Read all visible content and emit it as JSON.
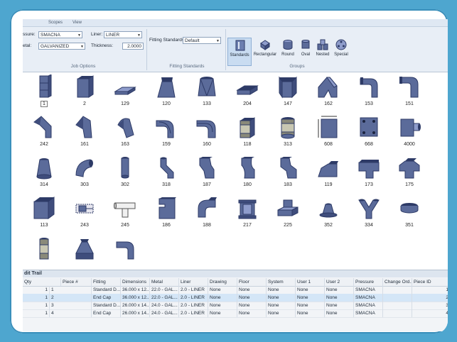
{
  "ribbon": {
    "tabs": [
      "Scopes",
      "View"
    ],
    "pressure_label": "ssure:",
    "pressure_value": "SMACNA",
    "metal_label": "etal:",
    "metal_value": "GALVANIZED",
    "liner_label": "Liner:",
    "liner_value": "LINER",
    "thickness_label": "Thickness:",
    "thickness_value": "2.0000",
    "job_options_title": "Job Options",
    "fitting_standards_label": "Fitting Standards",
    "fitting_standards_value": "Default",
    "fitting_standards_title": "Fitting Standards",
    "groups_title": "Groups",
    "groups": [
      {
        "label": "Standards",
        "icon": "standards-icon",
        "active": true
      },
      {
        "label": "Rectangular",
        "icon": "rectangular-icon",
        "active": false
      },
      {
        "label": "Round",
        "icon": "round-icon",
        "active": false
      },
      {
        "label": "Oval",
        "icon": "oval-icon",
        "active": false
      },
      {
        "label": "Nested",
        "icon": "nested-icon",
        "active": false
      },
      {
        "label": "Special",
        "icon": "special-icon",
        "active": false
      }
    ]
  },
  "fittings": [
    [
      "1",
      "2",
      "129",
      "120",
      "133",
      "204",
      "147",
      "162",
      "153",
      "151"
    ],
    [
      "242",
      "161",
      "163",
      "159",
      "160",
      "118",
      "313",
      "608",
      "668",
      "4000"
    ],
    [
      "314",
      "303",
      "302",
      "318",
      "187",
      "180",
      "183",
      "119",
      "173",
      "175"
    ],
    [
      "113",
      "243",
      "245",
      "186",
      "188",
      "217",
      "225",
      "352",
      "334",
      "351"
    ],
    [
      "",
      "",
      ""
    ]
  ],
  "audit": {
    "title": "dit Trail",
    "columns": [
      "Qty",
      "Piece #",
      "Fitting",
      "Dimensions",
      "Metal",
      "Liner",
      "Drawing",
      "Floor",
      "System",
      "User 1",
      "User 2",
      "Pressure",
      "Change Ord...",
      "Piece ID"
    ],
    "rows": [
      [
        "1",
        "1",
        "Standard D...",
        "36.000 x 12...",
        "22.0 - GAL...",
        "2.0 - LINER",
        "None",
        "None",
        "None",
        "None",
        "None",
        "SMACNA",
        "",
        "1"
      ],
      [
        "1",
        "2",
        "End Cap",
        "36.000 x 12...",
        "22.0 - GAL...",
        "2.0 - LINER",
        "None",
        "None",
        "None",
        "None",
        "None",
        "SMACNA",
        "",
        "2"
      ],
      [
        "1",
        "3",
        "Standard D...",
        "26.000 x 14...",
        "24.0 - GAL...",
        "2.0 - LINER",
        "None",
        "None",
        "None",
        "None",
        "None",
        "SMACNA",
        "",
        "3"
      ],
      [
        "1",
        "4",
        "End Cap",
        "26.000 x 14...",
        "24.0 - GAL...",
        "2.0 - LINER",
        "None",
        "None",
        "None",
        "None",
        "None",
        "SMACNA",
        "",
        "4"
      ]
    ],
    "selected_row": 1
  },
  "colors": {
    "accent_blue": "#5b6b9a",
    "accent_dark": "#2d3a66",
    "background": "#4ea6cf"
  }
}
